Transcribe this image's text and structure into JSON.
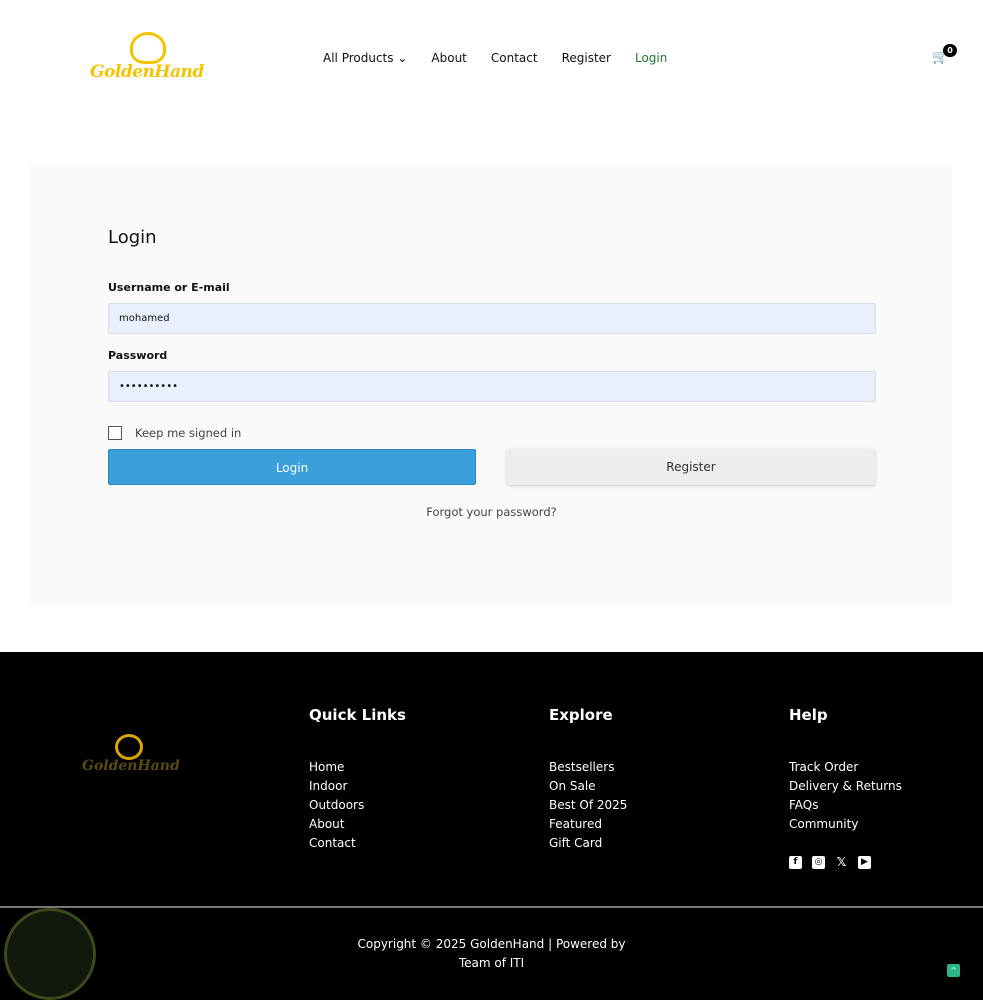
{
  "brand": {
    "name": "GoldenHand"
  },
  "nav": {
    "items": [
      "All Products",
      "About",
      "Contact",
      "Register",
      "Login"
    ],
    "active": "Login",
    "cart_count": "0"
  },
  "login": {
    "title": "Login",
    "username_label": "Username or E-mail",
    "username_value": "mohamed",
    "password_label": "Password",
    "password_value": "••••••••••",
    "remember_label": "Keep me signed in",
    "login_button": "Login",
    "register_button": "Register",
    "forgot": "Forgot your password?"
  },
  "footer": {
    "quick": {
      "title": "Quick Links",
      "items": [
        "Home",
        "Indoor",
        "Outdoors",
        "About",
        "Contact"
      ]
    },
    "explore": {
      "title": "Explore",
      "items": [
        "Bestsellers",
        "On Sale",
        "Best Of 2025",
        "Featured",
        "Gift Card"
      ]
    },
    "help": {
      "title": "Help",
      "items": [
        "Track Order",
        "Delivery & Returns",
        "FAQs",
        "Community"
      ]
    },
    "social": [
      "facebook-icon",
      "instagram-icon",
      "x-icon",
      "youtube-icon"
    ],
    "copyright1": "Copyright © 2025 GoldenHand | Powered by",
    "copyright2": "Team of ITI"
  },
  "colors": {
    "accent": "#3b9fdb",
    "brand": "#f5c400",
    "active_nav": "#1e7a2e"
  }
}
